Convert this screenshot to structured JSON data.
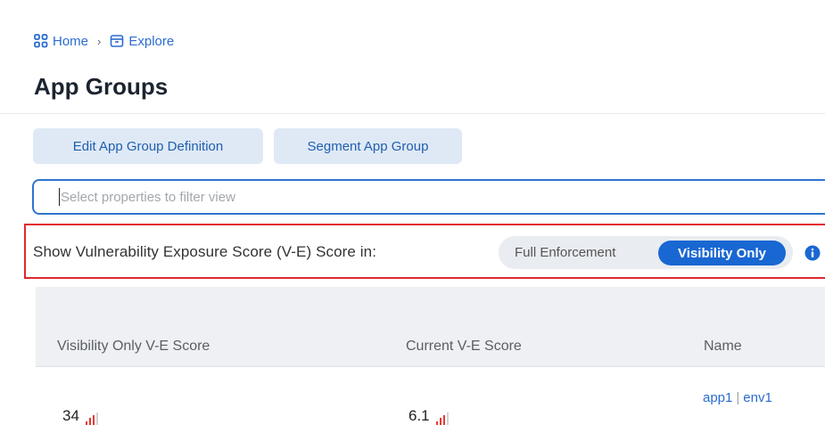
{
  "breadcrumb": {
    "home": "Home",
    "separator": "›",
    "explore": "Explore"
  },
  "page": {
    "title": "App Groups"
  },
  "actions": {
    "edit_label": "Edit App Group Definition",
    "segment_label": "Segment App Group"
  },
  "filter": {
    "placeholder": "Select properties to filter view"
  },
  "score_toggle": {
    "label": "Show Vulnerability Exposure Score (V-E) Score in:",
    "options": [
      "Full Enforcement",
      "Visibility Only"
    ],
    "selected": "Visibility Only"
  },
  "table": {
    "columns": [
      "Visibility Only V-E Score",
      "Current V-E Score",
      "Name"
    ],
    "rows": [
      {
        "visibility_score": "34",
        "current_score": "6.1",
        "name_app": "app1",
        "name_env": "env1"
      }
    ]
  },
  "colors": {
    "accent": "#1967d2",
    "link": "#2b6cd0",
    "highlight": "#e0282f",
    "bar_red": "#e53935"
  },
  "icons": [
    "home-grid-icon",
    "chevron-right-icon",
    "explore-box-icon",
    "info-icon",
    "signal-bars-icon"
  ]
}
